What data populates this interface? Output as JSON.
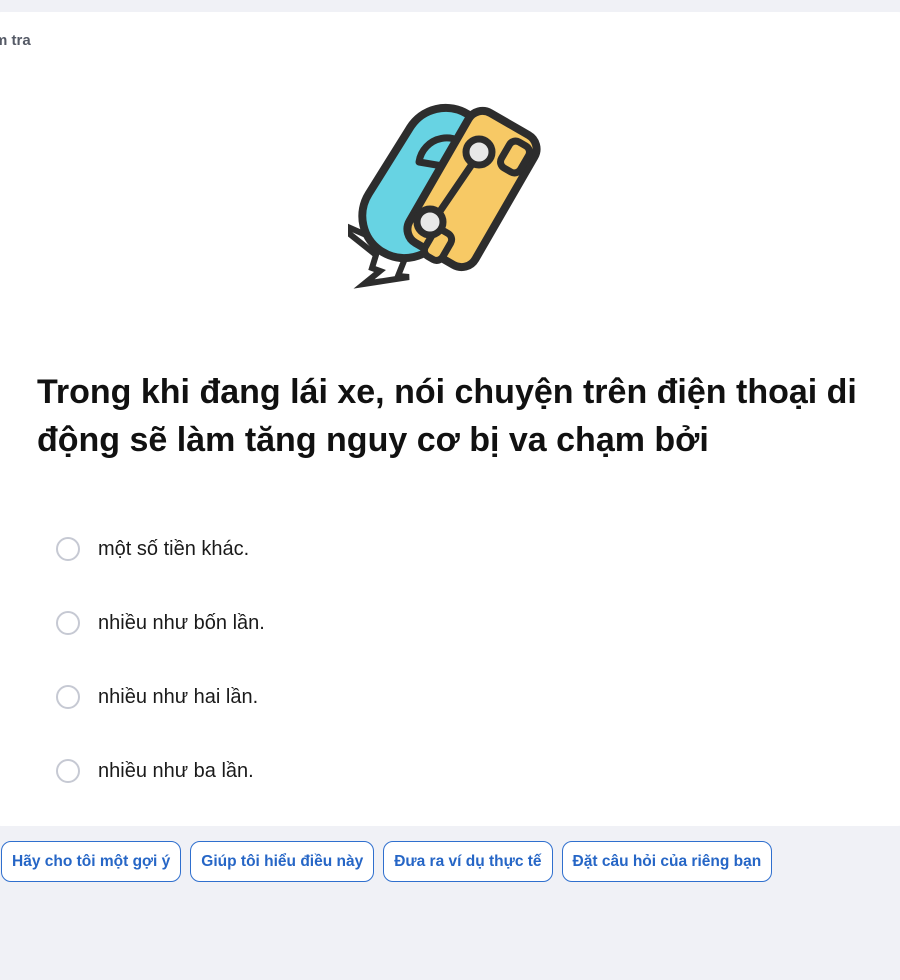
{
  "card": {
    "label": "m tra"
  },
  "illustration": {
    "icon": "car-crash-icon",
    "colors": {
      "car_blue": "#67d3e3",
      "car_yellow": "#f7c965",
      "outline": "#2d2d2d",
      "wheel": "#e8e8e8"
    }
  },
  "question": {
    "text": "Trong khi đang lái xe, nói chuyện trên điện thoại di động sẽ làm tăng nguy cơ bị va chạm bởi"
  },
  "options": [
    {
      "label": "một số tiền khác."
    },
    {
      "label": "nhiều như bốn lần."
    },
    {
      "label": "nhiều như hai lần."
    },
    {
      "label": "nhiều như ba lần."
    }
  ],
  "chips": [
    {
      "label": "Hãy cho tôi một gợi ý"
    },
    {
      "label": "Giúp tôi hiểu điều này"
    },
    {
      "label": "Đưa ra ví dụ thực tế"
    },
    {
      "label": "Đặt câu hỏi của riêng bạn"
    }
  ],
  "colors": {
    "page_bg": "#f0f1f6",
    "card_bg": "#ffffff",
    "accent": "#2666c6",
    "radio_border": "#c6c9d3"
  }
}
